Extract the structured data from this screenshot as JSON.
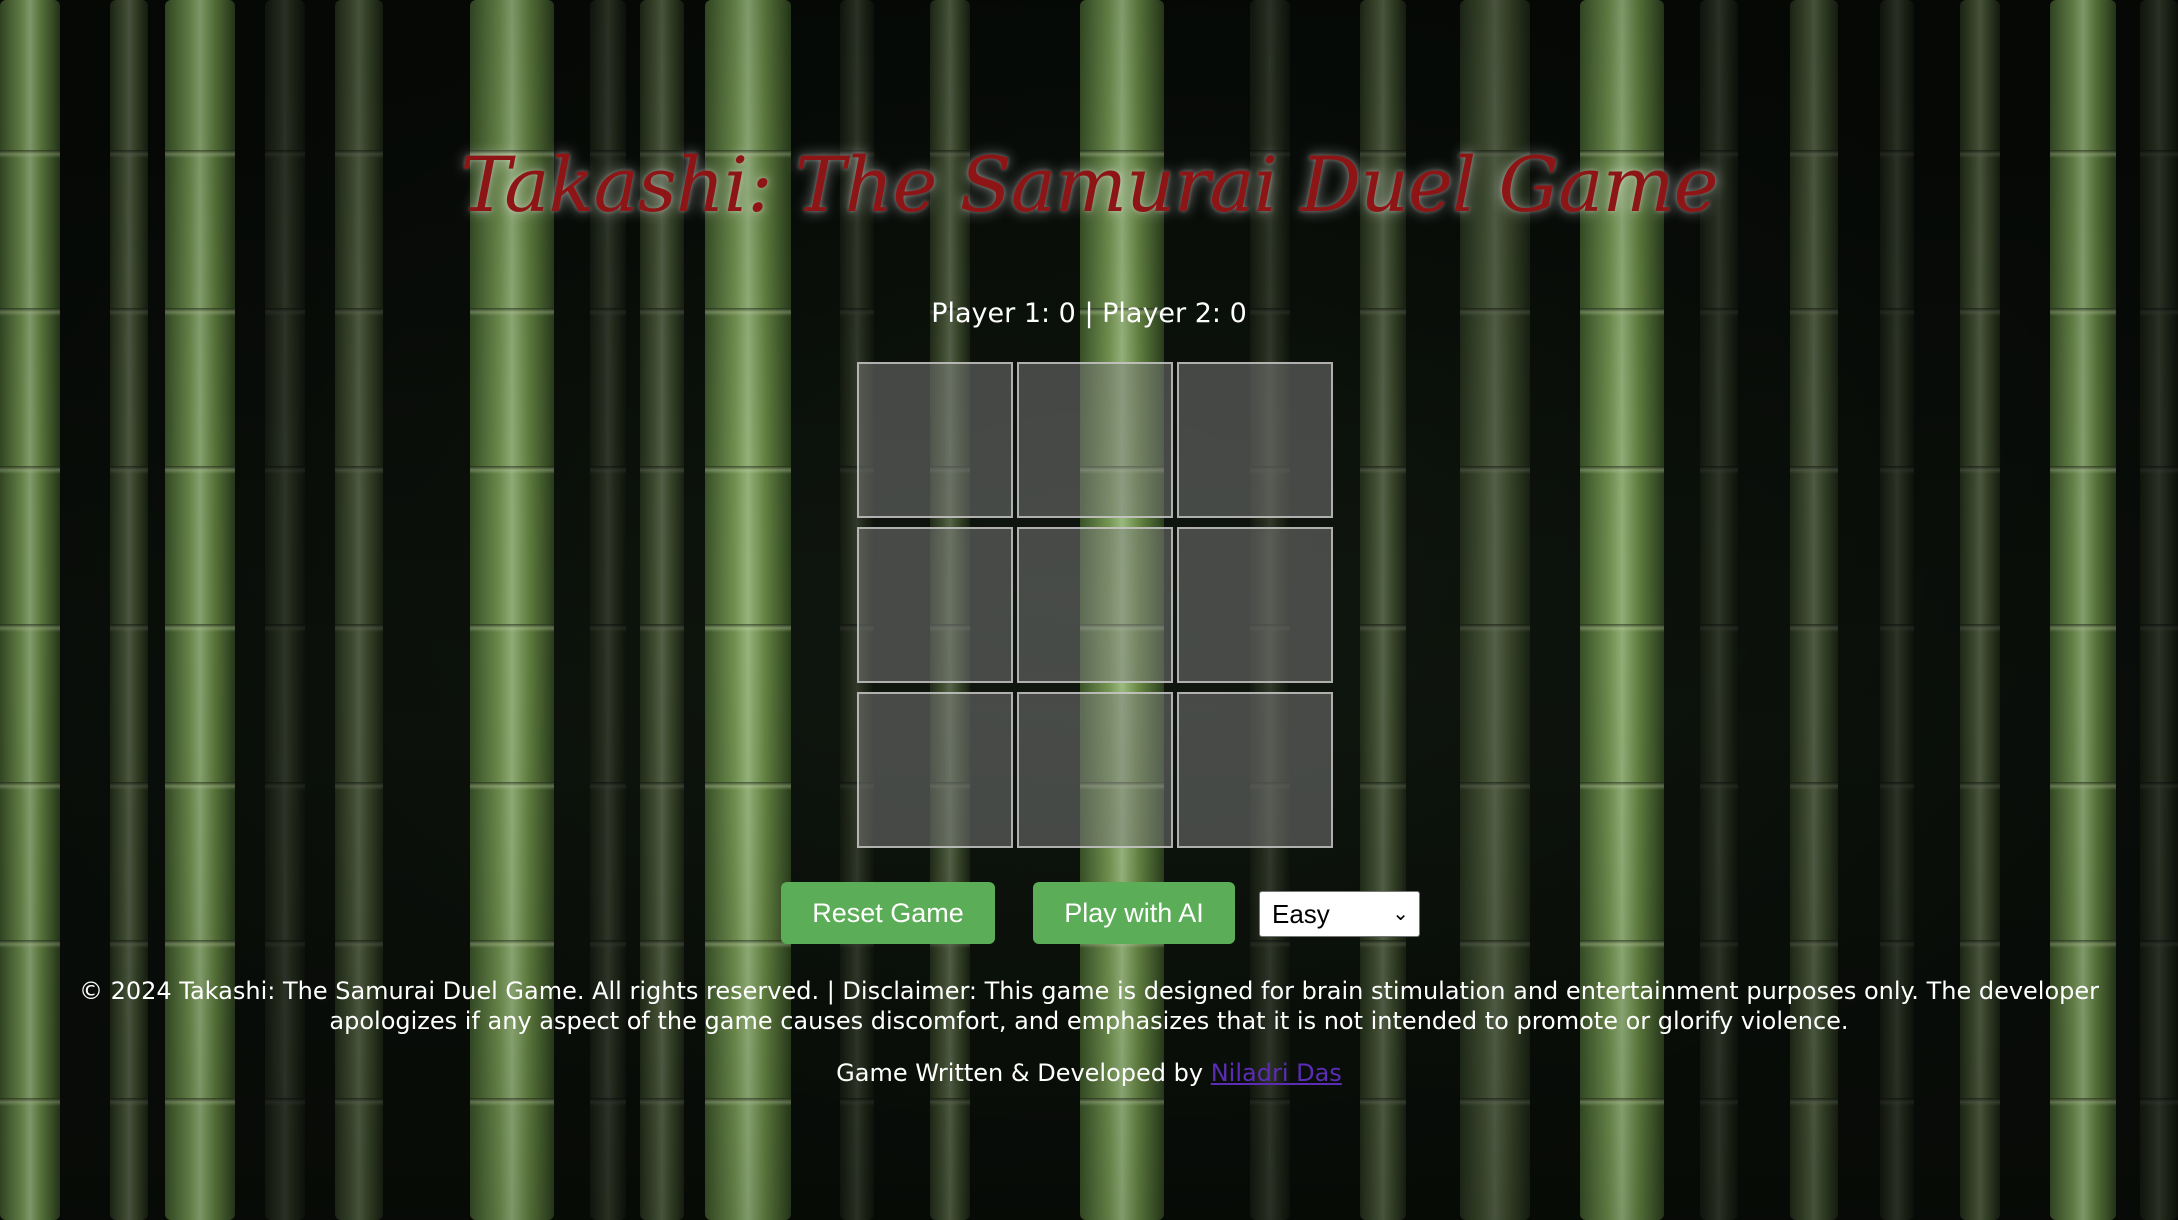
{
  "game": {
    "title": "Takashi: The Samurai Duel Game",
    "score_text": "Player 1: 0 | Player 2: 0",
    "board": {
      "cells": [
        "",
        "",
        "",
        "",
        "",
        "",
        "",
        "",
        ""
      ]
    }
  },
  "controls": {
    "reset_label": "Reset Game",
    "ai_label": "Play with AI",
    "difficulty": {
      "selected": "Easy"
    }
  },
  "footer": {
    "disclaimer": "© 2024 Takashi: The Samurai Duel Game. All rights reserved. | Disclaimer: This game is designed for brain stimulation and entertainment purposes only. The developer apologizes if any aspect of the game causes discomfort, and emphasizes that it is not intended to promote or glorify violence.",
    "credit_prefix": "Game Written & Developed by",
    "author_link": "Niladri Das"
  },
  "colors": {
    "title": "#8e1515",
    "button": "#5cad57",
    "link": "#5b2db5"
  }
}
